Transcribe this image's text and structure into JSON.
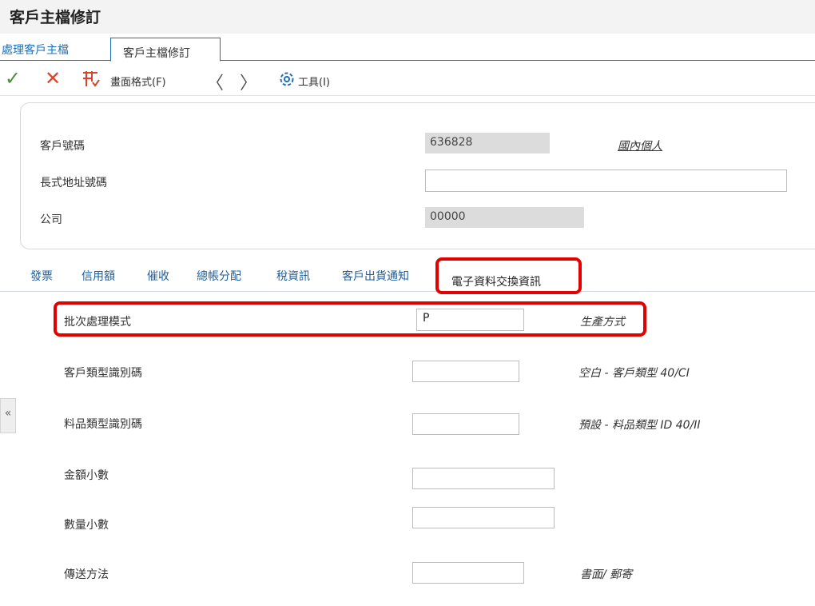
{
  "app": {
    "title": "客戶主檔修訂"
  },
  "tabs": {
    "parent": "處理客戶主檔",
    "current": "客戶主檔修訂"
  },
  "toolbar": {
    "format_label": "畫面格式(F)",
    "tools_label": "工具(I)"
  },
  "header": {
    "customer_no_label": "客戶號碼",
    "customer_no_value": "636828",
    "customer_type_link": "國內個人",
    "long_address_label": "長式地址號碼",
    "long_address_value": "",
    "company_label": "公司",
    "company_value": "00000"
  },
  "subtabs": [
    "發票",
    "信用額",
    "催收",
    "總帳分配",
    "稅資訊",
    "客戶出貨通知",
    "電子資料交換資訊"
  ],
  "fields": [
    {
      "label": "批次處理模式",
      "value": "P",
      "desc": "生產方式"
    },
    {
      "label": "客戶類型識別碼",
      "value": "",
      "desc": "空白 - 客戶類型 40/CI"
    },
    {
      "label": "料品類型識別碼",
      "value": "",
      "desc": "預設 - 料品類型 ID 40/II"
    },
    {
      "label": "金額小數",
      "value": "",
      "desc": ""
    },
    {
      "label": "數量小數",
      "value": "",
      "desc": ""
    },
    {
      "label": "傳送方法",
      "value": "",
      "desc": "書面/ 郵寄"
    }
  ],
  "side_handle": "«",
  "colors": {
    "accent": "#1e6fb8",
    "highlight": "#e30000",
    "readonly_bg": "#dcdcdc"
  }
}
